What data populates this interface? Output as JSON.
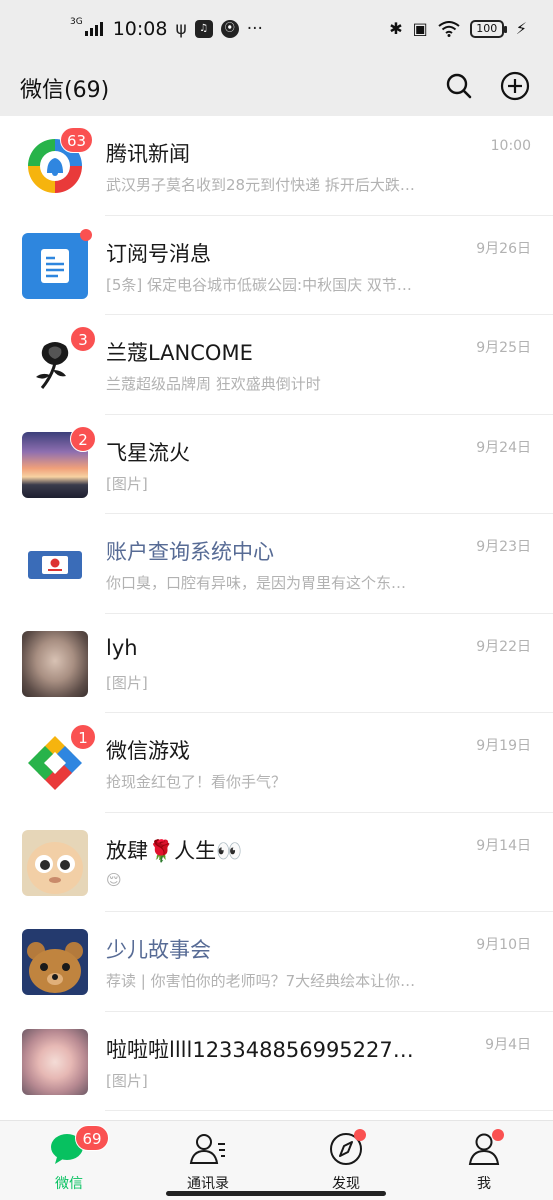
{
  "status_bar": {
    "network": "3G",
    "time": "10:08",
    "left_glyphs": [
      "ψ",
      "♫",
      "⦿",
      "···"
    ],
    "right_glyphs": [
      "✱",
      "▣",
      "wifi"
    ],
    "battery": "100",
    "charging": "⚡"
  },
  "header": {
    "title": "微信(69)",
    "search_icon": "search-icon",
    "add_icon": "plus-circle-icon"
  },
  "chats": [
    {
      "name": "腾讯新闻",
      "preview": "武汉男子莫名收到28元到付快递 拆开后大跌…",
      "time": "10:00",
      "badge": "63",
      "dot": false,
      "name_color": "normal",
      "avatar": "tencent-news-logo"
    },
    {
      "name": "订阅号消息",
      "preview": "[5条] 保定电谷城市低碳公园:中秋国庆 双节…",
      "time": "9月26日",
      "badge": "",
      "dot": true,
      "name_color": "normal",
      "avatar": "subscription-icon"
    },
    {
      "name": "兰蔻LANCOME",
      "preview": "兰蔻超级品牌周 狂欢盛典倒计时",
      "time": "9月25日",
      "badge": "3",
      "dot": false,
      "name_color": "normal",
      "avatar": "rose-logo"
    },
    {
      "name": "飞星流火",
      "preview": "[图片]",
      "time": "9月24日",
      "badge": "2",
      "dot": false,
      "name_color": "normal",
      "avatar": "sunset-photo"
    },
    {
      "name": "账户查询系统中心",
      "preview": "你口臭，口腔有异味，是因为胃里有这个东…",
      "time": "9月23日",
      "badge": "",
      "dot": false,
      "name_color": "blue",
      "avatar": "bank-card"
    },
    {
      "name": "lyh",
      "preview": "[图片]",
      "time": "9月22日",
      "badge": "",
      "dot": false,
      "name_color": "normal",
      "avatar": "portrait-photo"
    },
    {
      "name": "微信游戏",
      "preview": "抢现金红包了！看你手气？",
      "time": "9月19日",
      "badge": "1",
      "dot": false,
      "name_color": "normal",
      "avatar": "wechat-games-logo"
    },
    {
      "name": "放肆🌹人生👀",
      "preview": "😌",
      "time": "9月14日",
      "badge": "",
      "dot": false,
      "name_color": "normal",
      "avatar": "cartoon-face"
    },
    {
      "name": "少儿故事会",
      "preview": "荐读 | 你害怕你的老师吗？7大经典绘本让你…",
      "time": "9月10日",
      "badge": "",
      "dot": false,
      "name_color": "blue",
      "avatar": "teddy-bear"
    },
    {
      "name": "啦啦啦llll123348856995227…",
      "preview": "[图片]",
      "time": "9月4日",
      "badge": "",
      "dot": false,
      "name_color": "normal",
      "avatar": "girl-photo"
    }
  ],
  "bottom_nav": [
    {
      "label": "微信",
      "icon": "chat-bubble-icon",
      "active": true,
      "badge": "69",
      "dot": false
    },
    {
      "label": "通讯录",
      "icon": "contacts-icon",
      "active": false,
      "badge": "",
      "dot": false
    },
    {
      "label": "发现",
      "icon": "compass-icon",
      "active": false,
      "badge": "",
      "dot": true
    },
    {
      "label": "我",
      "icon": "person-icon",
      "active": false,
      "badge": "",
      "dot": true
    }
  ],
  "colors": {
    "brand_green": "#07c160",
    "badge_red": "#fa5151",
    "official_blue": "#576b95",
    "header_bg": "#ededed"
  }
}
